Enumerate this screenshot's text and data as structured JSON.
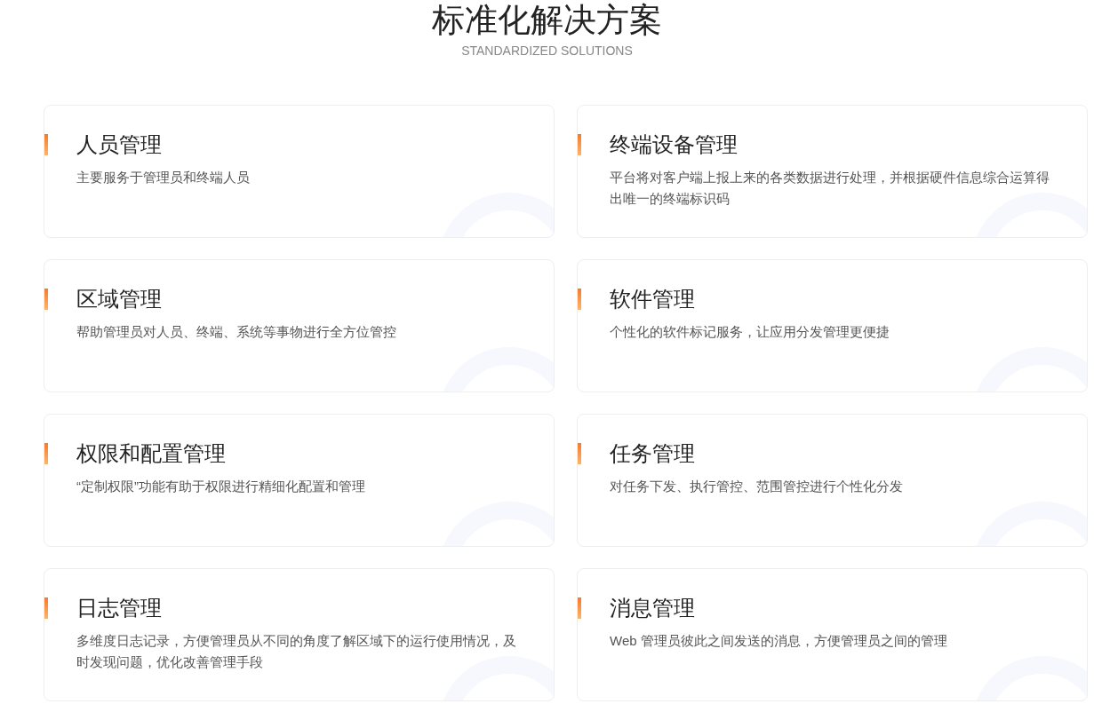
{
  "header": {
    "title": "标准化解决方案",
    "subtitle": "STANDARDIZED SOLUTIONS"
  },
  "cards": [
    {
      "title": "人员管理",
      "description": "主要服务于管理员和终端人员"
    },
    {
      "title": "终端设备管理",
      "description": "平台将对客户端上报上来的各类数据进行处理，并根据硬件信息综合运算得出唯一的终端标识码"
    },
    {
      "title": "区域管理",
      "description": "帮助管理员对人员、终端、系统等事物进行全方位管控"
    },
    {
      "title": "软件管理",
      "description": "个性化的软件标记服务，让应用分发管理更便捷"
    },
    {
      "title": "权限和配置管理",
      "description": "“定制权限”功能有助于权限进行精细化配置和管理"
    },
    {
      "title": "任务管理",
      "description": "对任务下发、执行管控、范围管控进行个性化分发"
    },
    {
      "title": "日志管理",
      "description": "多维度日志记录，方便管理员从不同的角度了解区域下的运行使用情况，及时发现问题，优化改善管理手段"
    },
    {
      "title": "消息管理",
      "description": "Web 管理员彼此之间发送的消息，方便管理员之间的管理"
    }
  ]
}
